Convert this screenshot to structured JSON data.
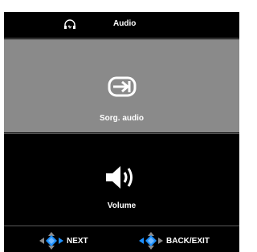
{
  "header": {
    "title": "Audio",
    "icon": "headphones-icon"
  },
  "menu": {
    "items": [
      {
        "label": "Sorg. audio",
        "icon": "audio-source-icon",
        "selected": true
      },
      {
        "label": "Volume",
        "icon": "speaker-volume-icon",
        "selected": false
      }
    ]
  },
  "footer": {
    "next_label": "NEXT",
    "back_label": "BACK/EXIT",
    "nav_icon": "dpad-icon"
  },
  "colors": {
    "background": "#000000",
    "selected": "#8a8a8a",
    "text": "#ffffff",
    "dpad_accent": "#1e90ff",
    "dpad_gray": "#8c8c8c"
  }
}
